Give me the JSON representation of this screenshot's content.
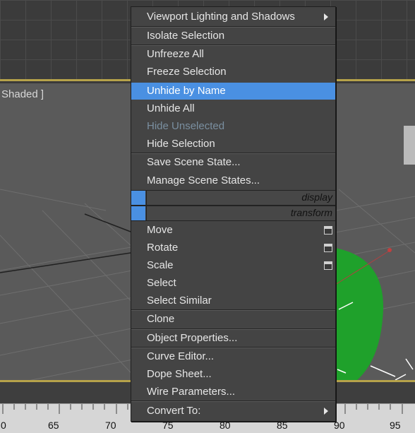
{
  "viewport": {
    "label": "Shaded ]",
    "sphere_color": "#1fa12b",
    "accent_frame_color": "#b6a24a"
  },
  "context_menu": {
    "items": [
      {
        "label": "Viewport Lighting and Shadows",
        "has_submenu": true
      },
      {
        "label": "Isolate Selection"
      },
      {
        "label": "Unfreeze All"
      },
      {
        "label": "Freeze Selection"
      },
      {
        "label": "Unhide by Name",
        "highlighted": true
      },
      {
        "label": "Unhide All"
      },
      {
        "label": "Hide Unselected",
        "disabled": true
      },
      {
        "label": "Hide Selection"
      },
      {
        "label": "Save Scene State..."
      },
      {
        "label": "Manage Scene States..."
      },
      {
        "label": "Move",
        "has_options": true
      },
      {
        "label": "Rotate",
        "has_options": true
      },
      {
        "label": "Scale",
        "has_options": true
      },
      {
        "label": "Select"
      },
      {
        "label": "Select Similar"
      },
      {
        "label": "Clone"
      },
      {
        "label": "Object Properties..."
      },
      {
        "label": "Curve Editor..."
      },
      {
        "label": "Dope Sheet..."
      },
      {
        "label": "Wire Parameters..."
      },
      {
        "label": "Convert To:",
        "has_submenu": true
      }
    ],
    "quad_headers": {
      "display": "display",
      "transform": "transform"
    },
    "highlight_color": "#4a90e2"
  },
  "timeline": {
    "ticks": [
      "65",
      "70",
      "75",
      "80",
      "85",
      "90",
      "95"
    ],
    "left_partial": "0"
  }
}
